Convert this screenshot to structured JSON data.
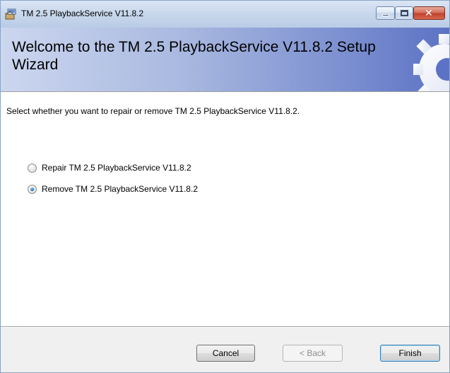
{
  "window": {
    "title": "TM 2.5 PlaybackService V11.8.2",
    "icon": "installer-icon",
    "controls": {
      "minimize": "minimize-icon",
      "maximize": "maximize-icon",
      "close": "close-icon",
      "close_glyph": "✕"
    }
  },
  "banner": {
    "title": "Welcome to the TM 2.5 PlaybackService V11.8.2 Setup Wizard",
    "icon": "gear-icon"
  },
  "content": {
    "instruction": "Select whether you want to repair or remove TM 2.5 PlaybackService V11.8.2.",
    "options": [
      {
        "label": "Repair TM 2.5 PlaybackService V11.8.2",
        "selected": false
      },
      {
        "label": "Remove TM 2.5 PlaybackService V11.8.2",
        "selected": true
      }
    ]
  },
  "buttons": {
    "cancel": "Cancel",
    "back": "< Back",
    "finish": "Finish",
    "back_enabled": false
  },
  "colors": {
    "banner_gradient_end": "#5c72c4",
    "radio_selected": "#1c6fc2",
    "close_button": "#c0402a"
  }
}
